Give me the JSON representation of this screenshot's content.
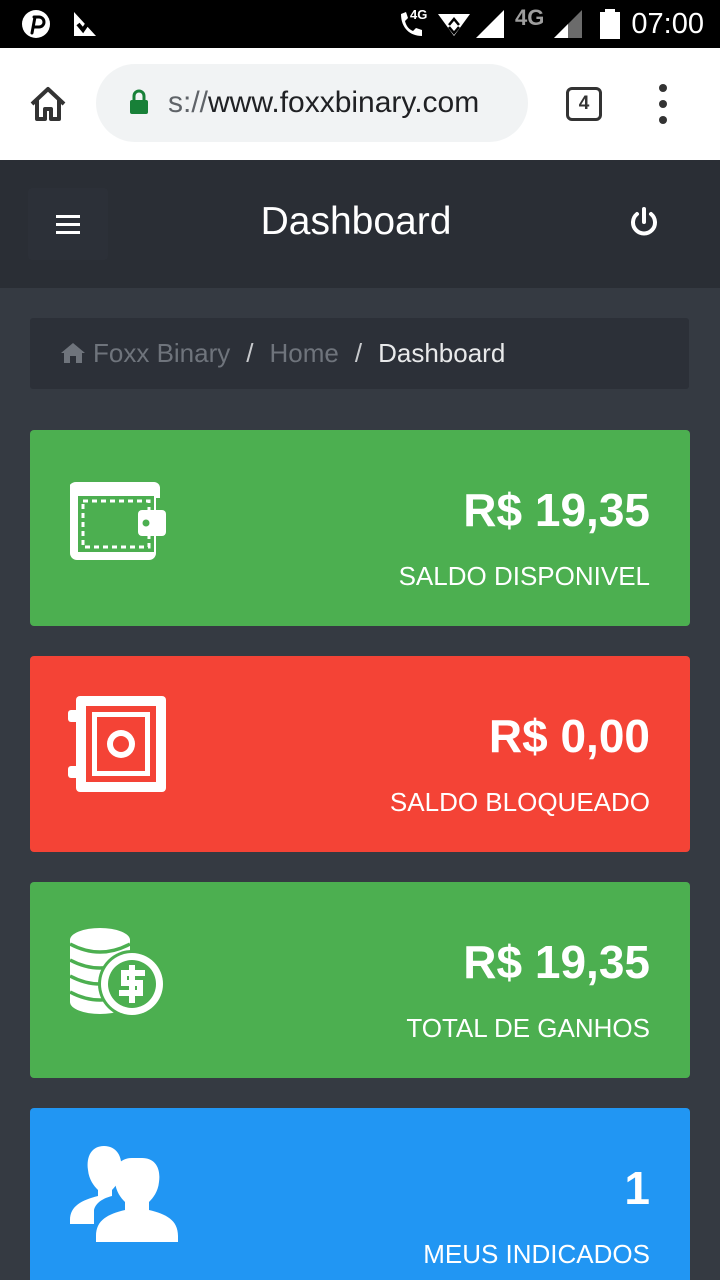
{
  "status_bar": {
    "time": "07:00",
    "network_small": "4G",
    "network_big": "4G"
  },
  "browser": {
    "url_scheme": "s://",
    "url_host": "www.foxxbinary.com",
    "tab_count": "4"
  },
  "header": {
    "title": "Dashboard"
  },
  "breadcrumb": {
    "items": [
      "Foxx Binary",
      "Home"
    ],
    "separator": "/",
    "active": "Dashboard"
  },
  "cards": [
    {
      "value": "R$ 19,35",
      "label": "SALDO DISPONIVEL",
      "color": "#4caf50",
      "icon": "wallet-icon"
    },
    {
      "value": "R$ 0,00",
      "label": "SALDO BLOQUEADO",
      "color": "#f44336",
      "icon": "safe-icon"
    },
    {
      "value": "R$ 19,35",
      "label": "TOTAL DE GANHOS",
      "color": "#4caf50",
      "icon": "coins-icon"
    },
    {
      "value": "1",
      "label": "MEUS INDICADOS",
      "color": "#2196f3",
      "icon": "users-icon"
    }
  ]
}
